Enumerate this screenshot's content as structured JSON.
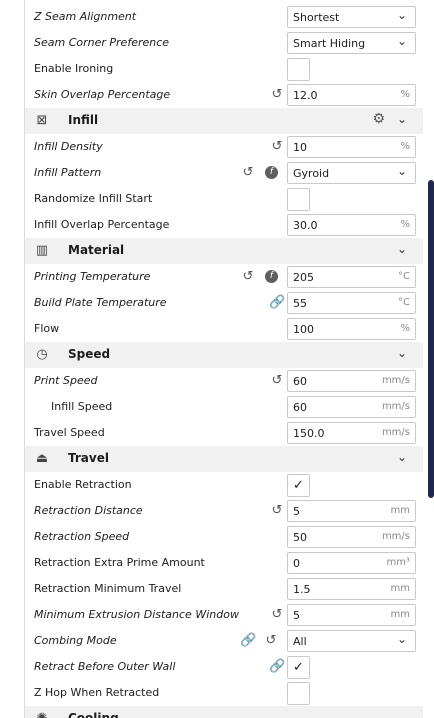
{
  "rows": [
    {
      "label": "Z Seam Alignment",
      "italic": true,
      "value": "Shortest",
      "dropdown": true
    },
    {
      "label": "Seam Corner Preference",
      "italic": true,
      "value": "Smart Hiding",
      "dropdown": true
    },
    {
      "label": "Enable Ironing",
      "italic": false,
      "checkbox": true,
      "checked": false
    },
    {
      "label": "Skin Overlap Percentage",
      "italic": true,
      "value": "12.0",
      "unit": "%",
      "reset": true
    },
    {
      "category": true,
      "label": "Infill",
      "icon": "infill-icon",
      "glyph": "⊠",
      "gear": true
    },
    {
      "label": "Infill Density",
      "italic": true,
      "value": "10",
      "unit": "%",
      "reset": true
    },
    {
      "label": "Infill Pattern",
      "italic": true,
      "value": "Gyroid",
      "dropdown": true,
      "reset": true,
      "fx": true
    },
    {
      "label": "Randomize Infill Start",
      "italic": false,
      "checkbox": true,
      "checked": false
    },
    {
      "label": "Infill Overlap Percentage",
      "italic": false,
      "value": "30.0",
      "unit": "%"
    },
    {
      "category": true,
      "label": "Material",
      "icon": "material-icon",
      "glyph": "▥"
    },
    {
      "label": "Printing Temperature",
      "italic": true,
      "value": "205",
      "unit": "°C",
      "reset": true,
      "fx": true
    },
    {
      "label": "Build Plate Temperature",
      "italic": true,
      "value": "55",
      "unit": "°C",
      "link": true
    },
    {
      "label": "Flow",
      "italic": false,
      "value": "100",
      "unit": "%"
    },
    {
      "category": true,
      "label": "Speed",
      "icon": "speed-icon",
      "glyph": "◷"
    },
    {
      "label": "Print Speed",
      "italic": true,
      "value": "60",
      "unit": "mm/s",
      "reset": true
    },
    {
      "label": "Infill Speed",
      "italic": false,
      "indent": true,
      "value": "60",
      "unit": "mm/s"
    },
    {
      "label": "Travel Speed",
      "italic": false,
      "value": "150.0",
      "unit": "mm/s"
    },
    {
      "category": true,
      "label": "Travel",
      "icon": "travel-icon",
      "glyph": "⏏"
    },
    {
      "label": "Enable Retraction",
      "italic": false,
      "checkbox": true,
      "checked": true
    },
    {
      "label": "Retraction Distance",
      "italic": true,
      "value": "5",
      "unit": "mm",
      "reset": true
    },
    {
      "label": "Retraction Speed",
      "italic": true,
      "value": "50",
      "unit": "mm/s"
    },
    {
      "label": "Retraction Extra Prime Amount",
      "italic": false,
      "value": "0",
      "unit": "mm³"
    },
    {
      "label": "Retraction Minimum Travel",
      "italic": false,
      "value": "1.5",
      "unit": "mm"
    },
    {
      "label": "Minimum Extrusion Distance Window",
      "italic": true,
      "value": "5",
      "unit": "mm",
      "reset": true
    },
    {
      "label": "Combing Mode",
      "italic": true,
      "value": "All",
      "dropdown": true,
      "reset": true,
      "link": true
    },
    {
      "label": "Retract Before Outer Wall",
      "italic": true,
      "checkbox": true,
      "checked": true,
      "link": true
    },
    {
      "label": "Z Hop When Retracted",
      "italic": false,
      "checkbox": true,
      "checked": false
    },
    {
      "category": true,
      "label": "Cooling",
      "icon": "cooling-icon",
      "glyph": "✺"
    }
  ],
  "glyphs": {
    "reset": "↺",
    "link": "🔗",
    "fx": "f",
    "chevron": "⌄",
    "gear": "⚙",
    "check": "✓"
  }
}
